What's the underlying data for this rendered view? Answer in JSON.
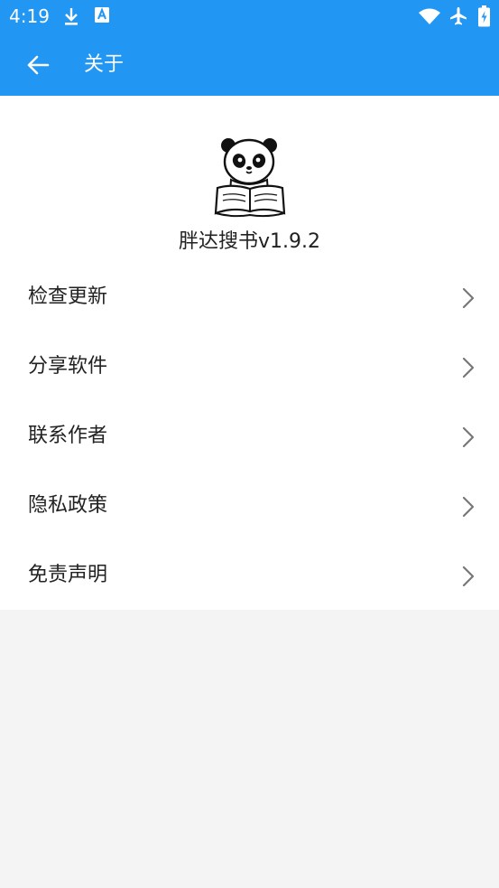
{
  "status_bar": {
    "time": "4:19",
    "icons_left": [
      "download-icon",
      "text-icon"
    ],
    "icons_right": [
      "wifi-icon",
      "airplane-icon",
      "battery-charging-icon"
    ]
  },
  "app_bar": {
    "title": "关于",
    "back_icon": "arrow-left-icon"
  },
  "about": {
    "logo_icon": "panda-reading-book-icon",
    "app_name": "胖达搜书v1.9.2"
  },
  "menu": {
    "items": [
      {
        "label": "检查更新"
      },
      {
        "label": "分享软件"
      },
      {
        "label": "联系作者"
      },
      {
        "label": "隐私政策"
      },
      {
        "label": "免责声明"
      }
    ]
  },
  "colors": {
    "primary": "#2196f3",
    "surface": "#ffffff",
    "background": "#f4f4f4",
    "text": "#222222",
    "chevron": "#777777"
  }
}
